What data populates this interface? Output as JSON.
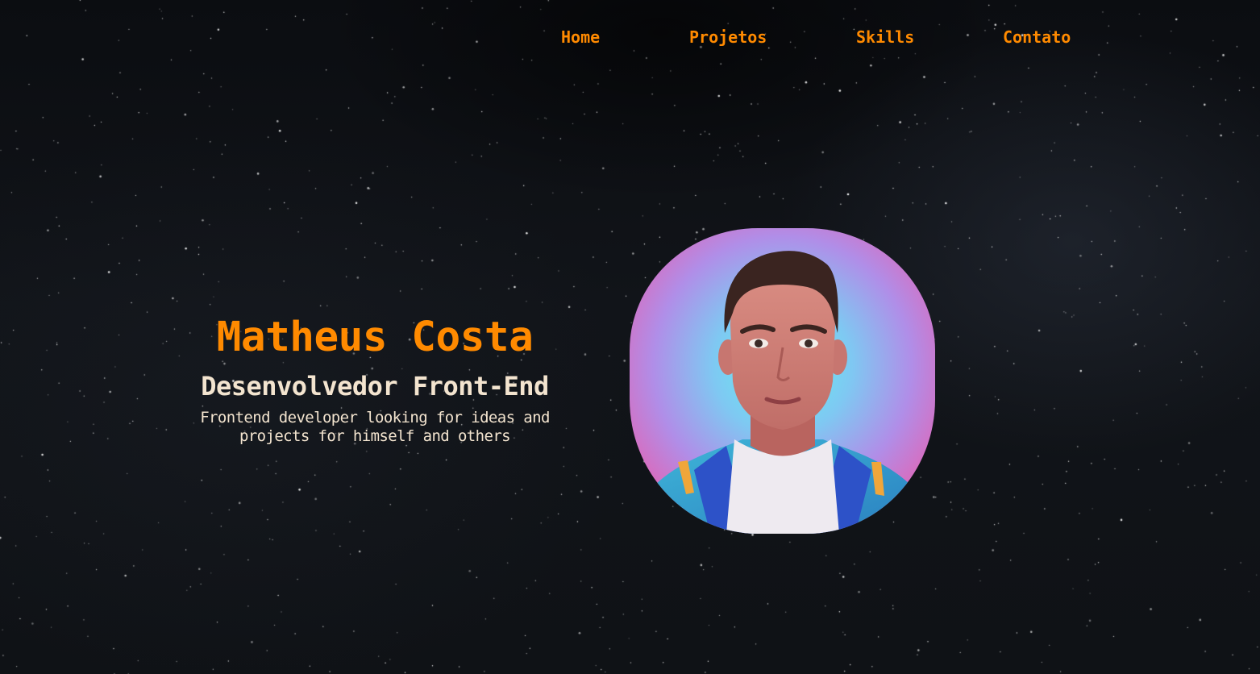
{
  "nav": {
    "links": [
      {
        "label": "Home"
      },
      {
        "label": "Projetos"
      },
      {
        "label": "Skills"
      },
      {
        "label": "Contato"
      }
    ]
  },
  "hero": {
    "name": "Matheus Costa",
    "role": "Desenvolvedor Front-End",
    "description": "Frontend developer looking for ideas and projects for himself and others",
    "avatar_icon": "profile-portrait-illustration"
  },
  "colors": {
    "accent": "#ff8a00",
    "text_light": "#f3e4cf",
    "background": "#0e1115"
  }
}
